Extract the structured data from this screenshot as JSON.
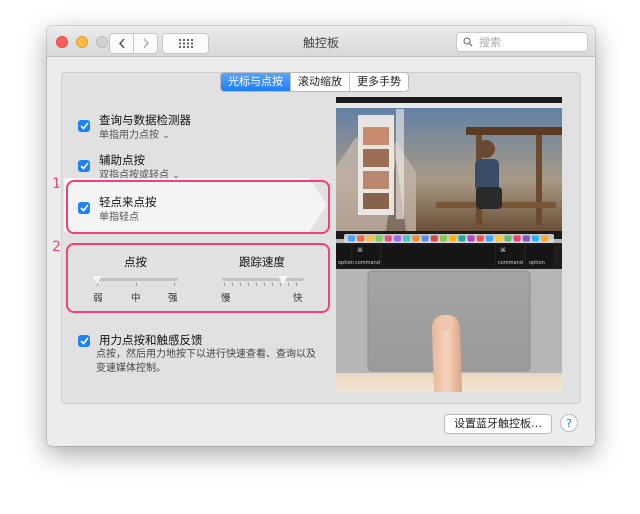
{
  "window": {
    "title": "触控板"
  },
  "search": {
    "placeholder": "搜索"
  },
  "tabs": [
    {
      "label": "光标与点按",
      "active": true
    },
    {
      "label": "滚动缩放",
      "active": false
    },
    {
      "label": "更多手势",
      "active": false
    }
  ],
  "options": [
    {
      "title": "查询与数据检测器",
      "subtitle": "单指用力点按",
      "has_dropdown": true,
      "checked": true
    },
    {
      "title": "辅助点按",
      "subtitle": "双指点按或轻点",
      "has_dropdown": true,
      "checked": true
    },
    {
      "title": "轻点来点按",
      "subtitle": "单指轻点",
      "has_dropdown": false,
      "checked": true
    },
    {
      "title": "用力点按和触感反馈",
      "subtitle": "点按，然后用力地按下以进行快速查看、查询以及变速媒体控制。",
      "checked": true
    }
  ],
  "annotations": [
    "1",
    "2"
  ],
  "sliders": {
    "click": {
      "label": "点按",
      "min_label": "弱",
      "mid_label": "中",
      "max_label": "强",
      "value": 0.0
    },
    "tracking": {
      "label": "跟踪速度",
      "min_label": "慢",
      "max_label": "快",
      "value": 0.75
    }
  },
  "preview": {
    "keys": [
      "command",
      "option",
      "command",
      "option"
    ],
    "key_symbol": "⌘"
  },
  "footer": {
    "bluetooth_button": "设置蓝牙触控板…",
    "help_button": "?"
  },
  "colors": {
    "accent": "#1d82f5",
    "highlight": "#f04274"
  }
}
